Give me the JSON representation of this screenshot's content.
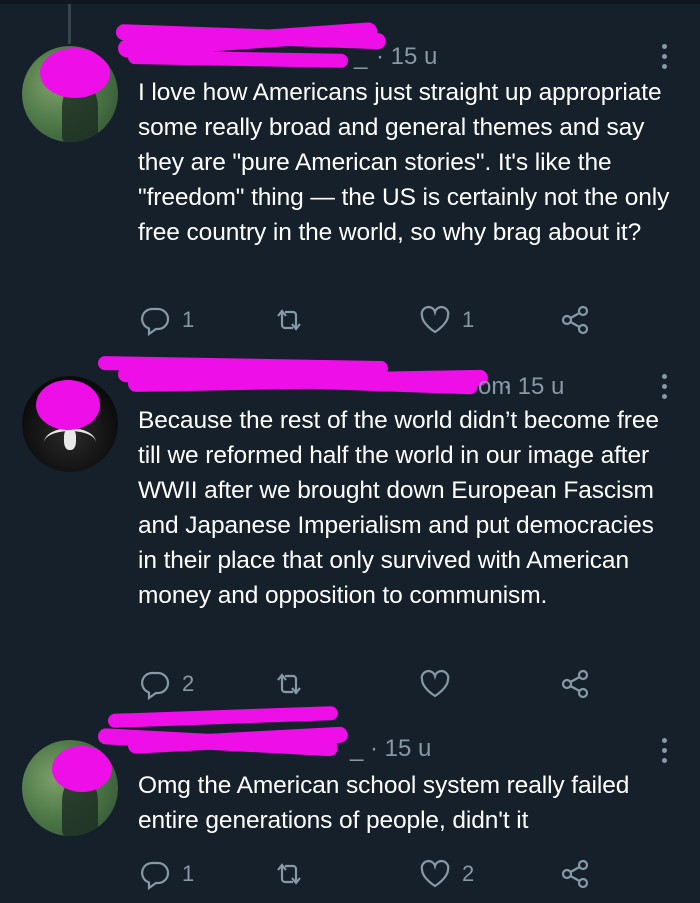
{
  "tweets": [
    {
      "name_visible": "_",
      "time": "15 u",
      "text": "I love how Americans just straight up appropriate some really broad and general themes and say they are \"pure American stories\". It's like the \"freedom\" thing — the US is certainly not the only free country in the world, so why brag about it?",
      "replies": "1",
      "retweets": "",
      "likes": "1"
    },
    {
      "name_visible": "om",
      "time": "15 u",
      "text": "Because the rest of the world didn’t become free till we reformed half the world in our image after WWII after we brought down European Fascism and Japanese Imperialism and put democracies in their place that only survived with American money and opposition to communism.",
      "replies": "2",
      "retweets": "",
      "likes": ""
    },
    {
      "name_visible": "_",
      "time": "15 u",
      "text": "Omg the American school system really failed entire generations of people, didn't it",
      "replies": "1",
      "retweets": "",
      "likes": "2"
    }
  ],
  "icons": {
    "reply": "reply-icon",
    "retweet": "retweet-icon",
    "like": "heart-icon",
    "share": "share-icon",
    "more": "more-options-icon"
  },
  "colors": {
    "background": "#15202b",
    "text": "#ffffff",
    "secondary": "#8899a6",
    "redaction": "#ee0ee8"
  }
}
